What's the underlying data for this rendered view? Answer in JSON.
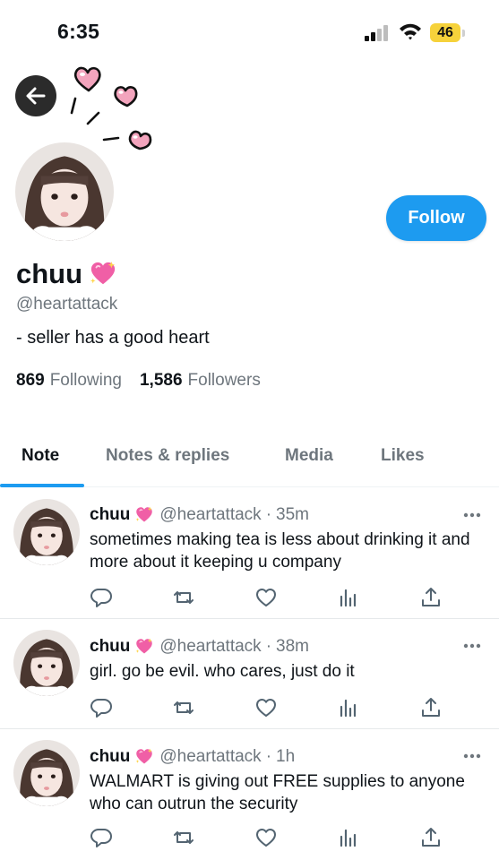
{
  "status_bar": {
    "time": "6:35",
    "battery_level": "46",
    "icons": [
      "signal-icon",
      "wifi-icon",
      "battery-icon"
    ]
  },
  "header": {
    "back_icon": "arrow-left-icon"
  },
  "profile": {
    "display_name": "chuu",
    "name_emoji": "sparkling-heart",
    "handle": "@heartattack",
    "bio": "- seller has a good heart",
    "following_count": "869",
    "following_label": "Following",
    "followers_count": "1,586",
    "followers_label": "Followers",
    "follow_button": "Follow"
  },
  "tabs": [
    {
      "label": "Note",
      "active": true
    },
    {
      "label": "Notes & replies",
      "active": false
    },
    {
      "label": "Media",
      "active": false
    },
    {
      "label": "Likes",
      "active": false
    }
  ],
  "posts": [
    {
      "name": "chuu",
      "handle": "@heartattack",
      "time": "35m",
      "separator": "·",
      "text": "sometimes making tea is less about drinking it and more about it keeping u company"
    },
    {
      "name": "chuu",
      "handle": "@heartattack",
      "time": "38m",
      "separator": "·",
      "text": "girl. go be evil. who cares, just do it"
    },
    {
      "name": "chuu",
      "handle": "@heartattack",
      "time": "1h",
      "separator": "·",
      "text": "WALMART is giving out FREE supplies to anyone who can outrun the security"
    }
  ],
  "action_icons": [
    "reply-icon",
    "repost-icon",
    "like-icon",
    "views-icon",
    "share-icon"
  ],
  "colors": {
    "accent": "#1d9bf0",
    "text": "#0f1419",
    "secondary": "#6e767d",
    "battery": "#f6d23b"
  }
}
